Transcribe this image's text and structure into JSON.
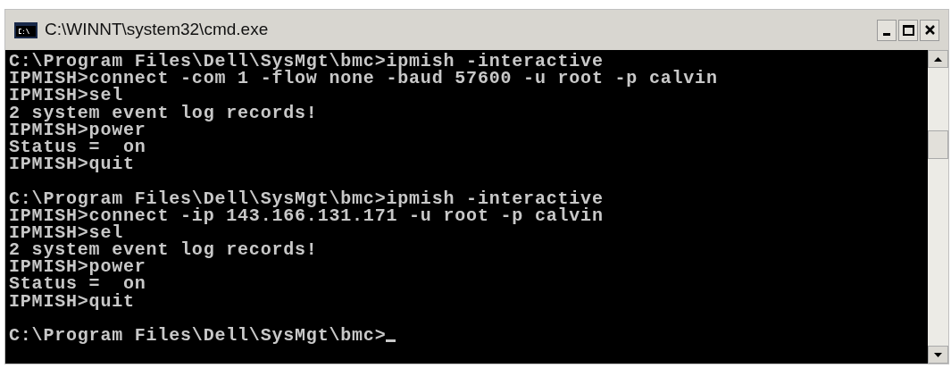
{
  "window": {
    "title": "C:\\WINNT\\system32\\cmd.exe"
  },
  "console": {
    "blocks": [
      [
        "C:\\Program Files\\Dell\\SysMgt\\bmc>ipmish -interactive",
        "IPMISH>connect -com 1 -flow none -baud 57600 -u root -p calvin",
        "IPMISH>sel",
        "2 system event log records!",
        "IPMISH>power",
        "Status =  on",
        "IPMISH>quit"
      ],
      [
        "C:\\Program Files\\Dell\\SysMgt\\bmc>ipmish -interactive",
        "IPMISH>connect -ip 143.166.131.171 -u root -p calvin",
        "IPMISH>sel",
        "2 system event log records!",
        "IPMISH>power",
        "Status =  on",
        "IPMISH>quit"
      ],
      [
        "C:\\Program Files\\Dell\\SysMgt\\bmc>"
      ]
    ],
    "cursor_visible": true
  }
}
